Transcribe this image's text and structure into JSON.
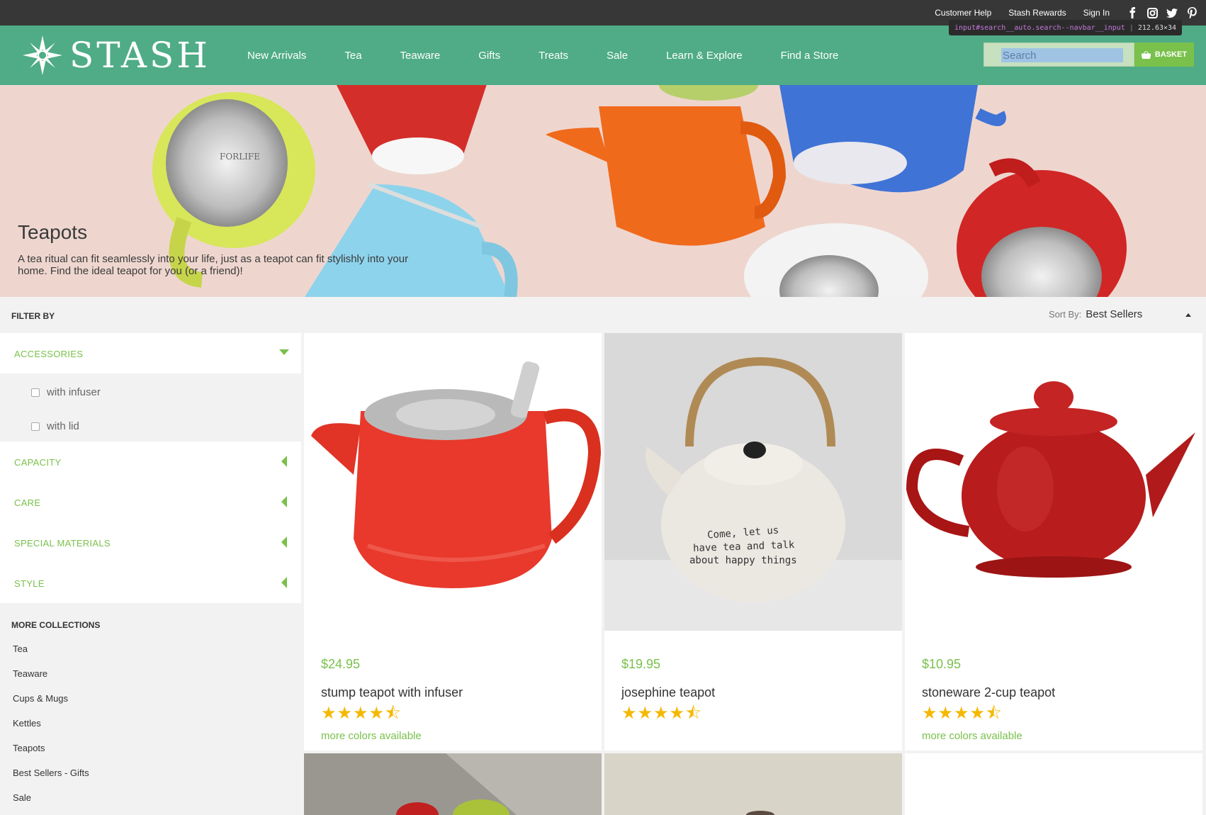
{
  "topbar": {
    "links": [
      "Customer Help",
      "Stash Rewards",
      "Sign In"
    ],
    "social": [
      {
        "icon": "facebook-icon",
        "glyph": "f"
      },
      {
        "icon": "instagram-icon",
        "glyph": "◙"
      },
      {
        "icon": "twitter-icon",
        "glyph": "🐦"
      },
      {
        "icon": "pinterest-icon",
        "glyph": "℗"
      }
    ]
  },
  "brand": {
    "name": "STASH",
    "color": "#4fac86",
    "accent": "#79c14b"
  },
  "nav": {
    "items": [
      "New Arrivals",
      "Tea",
      "Teaware",
      "Gifts",
      "Treats",
      "Sale",
      "Learn & Explore",
      "Find a Store"
    ],
    "search_placeholder": "Search",
    "basket_label": "BASKET"
  },
  "devtools_tip": {
    "selector": "input#search__auto.search--navbar__input",
    "size": "212.63×34"
  },
  "hero": {
    "title": "Teapots",
    "description": "A tea ritual can fit seamlessly into your life, just as a teapot can fit stylishly into your home. Find the ideal teapot for you (or a friend)!"
  },
  "filter": {
    "label": "FILTER BY",
    "sort_label": "Sort By:",
    "sort_value": "Best Sellers",
    "groups": [
      {
        "title": "ACCESSORIES",
        "expanded": true,
        "options": [
          "with infuser",
          "with lid"
        ]
      },
      {
        "title": "CAPACITY",
        "expanded": false
      },
      {
        "title": "CARE",
        "expanded": false
      },
      {
        "title": "SPECIAL MATERIALS",
        "expanded": false
      },
      {
        "title": "STYLE",
        "expanded": false
      }
    ]
  },
  "collections": {
    "title": "MORE COLLECTIONS",
    "items": [
      "Tea",
      "Teaware",
      "Cups & Mugs",
      "Kettles",
      "Teapots",
      "Best Sellers - Gifts",
      "Sale"
    ]
  },
  "products": [
    {
      "price": "$24.95",
      "name": "stump teapot with infuser",
      "rating": 4.5,
      "more": "more colors available",
      "color": "#e8392c"
    },
    {
      "price": "$19.95",
      "name": "josephine teapot",
      "rating": 4.5,
      "more": "",
      "color": "#e9e6df",
      "inscription": [
        "Come, let us",
        "have tea and talk",
        "about happy things"
      ]
    },
    {
      "price": "$10.95",
      "name": "stoneware 2-cup teapot",
      "rating": 4.5,
      "more": "more colors available",
      "color": "#b81c1c"
    }
  ],
  "hero_logo_text": "FORLIFE"
}
